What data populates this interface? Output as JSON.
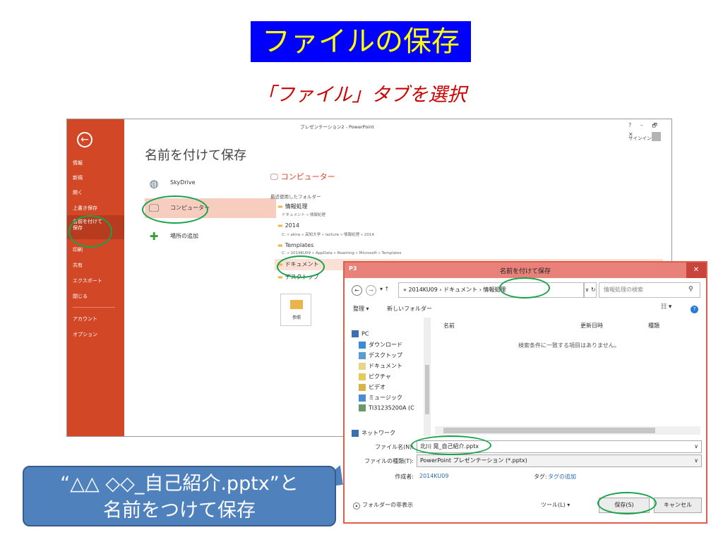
{
  "slide": {
    "title": "ファイルの保存",
    "subtitle": "「ファイル」タブを選択"
  },
  "ppt": {
    "window_title": "プレゼンテーション2 - PowerPoint",
    "window_controls": "? – 🗗 ✕",
    "signin": "サインイン",
    "back_icon": "←",
    "sidebar": [
      "情報",
      "新規",
      "開く",
      "上書き保存",
      "名前を付けて\n保存",
      "印刷",
      "共有",
      "エクスポート",
      "閉じる",
      "アカウント",
      "オプション"
    ],
    "page_title": "名前を付けて保存",
    "places": [
      {
        "label": "SkyDrive",
        "icon": "globe-icon"
      },
      {
        "label": "コンピューター",
        "icon": "computer-icon"
      },
      {
        "label": "場所の追加",
        "icon": "plus-icon"
      }
    ],
    "computer_heading": "コンピューター",
    "recent_label": "最近使用したフォルダー",
    "folders": [
      {
        "name": "情報処理",
        "path": "ドキュメント » 情報処理"
      },
      {
        "name": "2014",
        "path": "C: » akira » 高知大学 » lecture » 情報処理 » 2014"
      },
      {
        "name": "Templates",
        "path": "C: » 2014KU09 » AppData » Roaming » Microsoft » Templates"
      },
      {
        "name": "ドキュメント",
        "path": ""
      },
      {
        "name": "デスクトップ",
        "path": ""
      }
    ],
    "browse_label": "参照"
  },
  "dialog": {
    "app_icon": "P3",
    "title": "名前を付けて保存",
    "close": "✕",
    "nav_back": "←",
    "nav_forward": "→",
    "nav_up": "▾ ↑",
    "breadcrumb": "« 2014KU09 › ドキュメント › 情報処理",
    "refresh": "∨ ↻",
    "search_placeholder": "情報処理の検索",
    "search_icon": "⚲",
    "organize": "整理 ▾",
    "new_folder": "新しいフォルダー",
    "view_icon": "☷ ▾",
    "help_icon": "?",
    "tree": [
      "PC",
      "ダウンロード",
      "デスクトップ",
      "ドキュメント",
      "ピクチャ",
      "ビデオ",
      "ミュージック",
      "TI31235200A (C",
      "ネットワーク"
    ],
    "col_name": "名前",
    "col_date": "更新日時",
    "col_type": "種類",
    "empty_message": "検索条件に一致する項目はありません。",
    "filename_label": "ファイル名(N):",
    "filename_value": "北川 晃_自己紹介.pptx",
    "filetype_label": "ファイルの種類(T):",
    "filetype_value": "PowerPoint プレゼンテーション (*.pptx)",
    "author_label": "作成者:",
    "author_value": "2014KU09",
    "tag_label": "タグ:",
    "tag_value": "タグの追加",
    "hide_folders": "フォルダーの非表示",
    "tools": "ツール(L)",
    "save": "保存(S)",
    "cancel": "キャンセル"
  },
  "callout": {
    "line1": "“△△ ◇◇_自己紹介.pptx”と",
    "line2": "名前をつけて保存"
  },
  "colors": {
    "title_bg": "#0000ff",
    "title_text": "#ffff00",
    "subtitle": "#cc0000",
    "ppt_accent": "#d24726",
    "highlight_oval": "#17a34a",
    "callout_bg": "#4f81bd"
  }
}
